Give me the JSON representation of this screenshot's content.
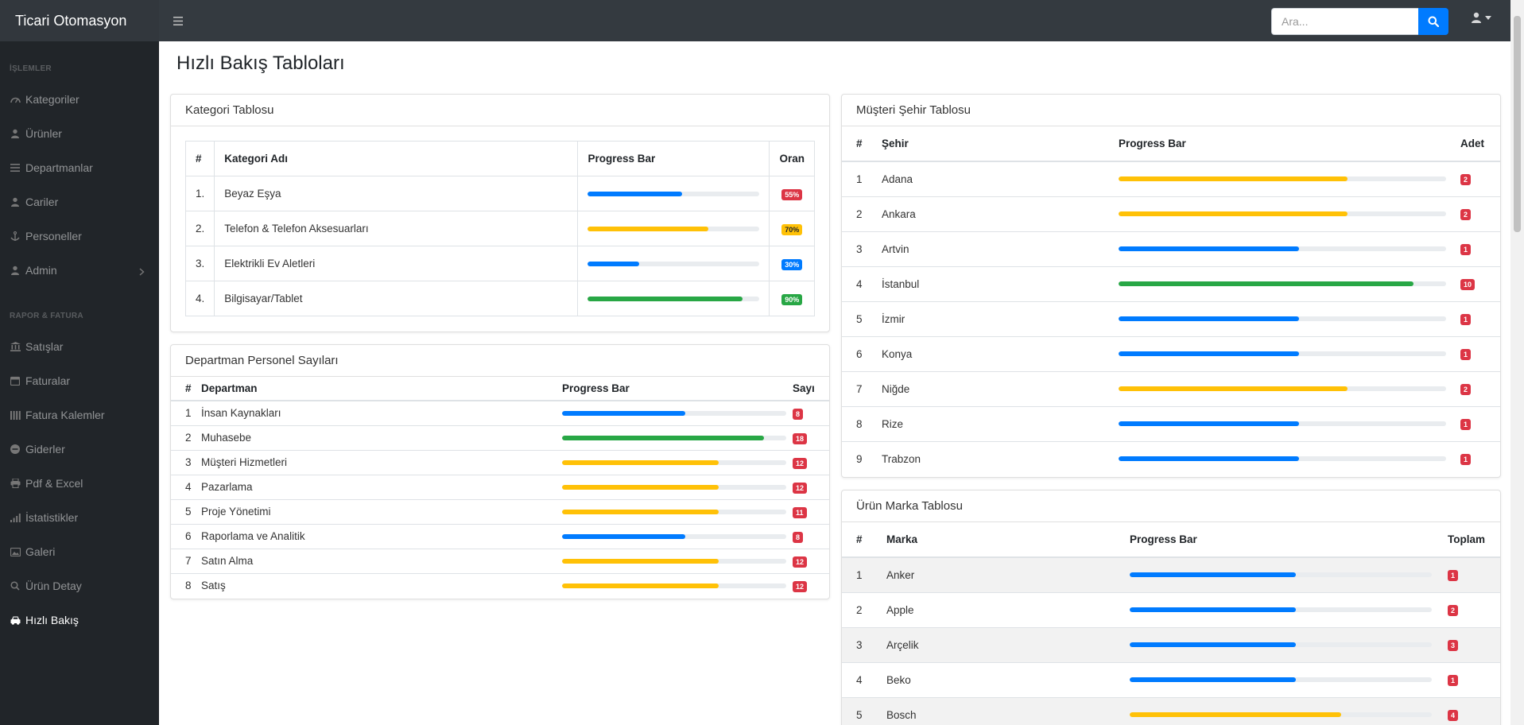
{
  "navbar": {
    "brand": "Ticari Otomasyon",
    "search_placeholder": "Ara..."
  },
  "sidebar": {
    "heading_ops": "İŞLEMLER",
    "heading_reports": "RAPOR & FATURA",
    "ops_items": [
      {
        "label": "Kategoriler",
        "icon": "dashboard-icon"
      },
      {
        "label": "Ürünler",
        "icon": "user-icon"
      },
      {
        "label": "Departmanlar",
        "icon": "list-icon"
      },
      {
        "label": "Cariler",
        "icon": "user-icon"
      },
      {
        "label": "Personeller",
        "icon": "anchor-icon"
      },
      {
        "label": "Admin",
        "icon": "user-icon"
      }
    ],
    "report_items": [
      {
        "label": "Satışlar",
        "icon": "bank-icon"
      },
      {
        "label": "Faturalar",
        "icon": "calendar-icon"
      },
      {
        "label": "Fatura Kalemler",
        "icon": "columns-icon"
      },
      {
        "label": "Giderler",
        "icon": "minus-circle-icon"
      },
      {
        "label": "Pdf & Excel",
        "icon": "print-icon"
      },
      {
        "label": "İstatistikler",
        "icon": "signal-icon"
      },
      {
        "label": "Galeri",
        "icon": "image-icon"
      },
      {
        "label": "Ürün Detay",
        "icon": "search-icon"
      },
      {
        "label": "Hızlı Bakış",
        "icon": "car-icon",
        "active": true
      }
    ]
  },
  "page_title": "Hızlı Bakış Tabloları",
  "colors": {
    "blue": "#007bff",
    "yellow": "#ffc107",
    "green": "#28a745",
    "red": "#dc3545"
  },
  "kategori": {
    "title": "Kategori Tablosu",
    "headers": [
      "#",
      "Kategori Adı",
      "Progress Bar",
      "Oran"
    ],
    "rows": [
      {
        "no": "1.",
        "name": "Beyaz Eşya",
        "progress": 55,
        "color": "blue",
        "badge": "55%",
        "badge_color": "red"
      },
      {
        "no": "2.",
        "name": "Telefon & Telefon Aksesuarları",
        "progress": 70,
        "color": "yellow",
        "badge": "70%",
        "badge_color": "yellow"
      },
      {
        "no": "3.",
        "name": "Elektrikli Ev Aletleri",
        "progress": 30,
        "color": "blue",
        "badge": "30%",
        "badge_color": "blue"
      },
      {
        "no": "4.",
        "name": "Bilgisayar/Tablet",
        "progress": 90,
        "color": "green",
        "badge": "90%",
        "badge_color": "green"
      }
    ]
  },
  "departman": {
    "title": "Departman Personel Sayıları",
    "headers": [
      "#",
      "Departman",
      "Progress Bar",
      "Sayı"
    ],
    "rows": [
      {
        "no": "1",
        "name": "İnsan Kaynakları",
        "progress": 55,
        "color": "blue",
        "count": "8"
      },
      {
        "no": "2",
        "name": "Muhasebe",
        "progress": 90,
        "color": "green",
        "count": "18"
      },
      {
        "no": "3",
        "name": "Müşteri Hizmetleri",
        "progress": 70,
        "color": "yellow",
        "count": "12"
      },
      {
        "no": "4",
        "name": "Pazarlama",
        "progress": 70,
        "color": "yellow",
        "count": "12"
      },
      {
        "no": "5",
        "name": "Proje Yönetimi",
        "progress": 70,
        "color": "yellow",
        "count": "11"
      },
      {
        "no": "6",
        "name": "Raporlama ve Analitik",
        "progress": 55,
        "color": "blue",
        "count": "8"
      },
      {
        "no": "7",
        "name": "Satın Alma",
        "progress": 70,
        "color": "yellow",
        "count": "12"
      },
      {
        "no": "8",
        "name": "Satış",
        "progress": 70,
        "color": "yellow",
        "count": "12"
      }
    ]
  },
  "musteri": {
    "title": "Müşteri Şehir Tablosu",
    "headers": [
      "#",
      "Şehir",
      "Progress Bar",
      "Adet"
    ],
    "rows": [
      {
        "no": "1",
        "name": "Adana",
        "progress": 70,
        "color": "yellow",
        "count": "2"
      },
      {
        "no": "2",
        "name": "Ankara",
        "progress": 70,
        "color": "yellow",
        "count": "2"
      },
      {
        "no": "3",
        "name": "Artvin",
        "progress": 55,
        "color": "blue",
        "count": "1"
      },
      {
        "no": "4",
        "name": "İstanbul",
        "progress": 90,
        "color": "green",
        "count": "10"
      },
      {
        "no": "5",
        "name": "İzmir",
        "progress": 55,
        "color": "blue",
        "count": "1"
      },
      {
        "no": "6",
        "name": "Konya",
        "progress": 55,
        "color": "blue",
        "count": "1"
      },
      {
        "no": "7",
        "name": "Niğde",
        "progress": 70,
        "color": "yellow",
        "count": "2"
      },
      {
        "no": "8",
        "name": "Rize",
        "progress": 55,
        "color": "blue",
        "count": "1"
      },
      {
        "no": "9",
        "name": "Trabzon",
        "progress": 55,
        "color": "blue",
        "count": "1"
      }
    ]
  },
  "marka": {
    "title": "Ürün Marka Tablosu",
    "headers": [
      "#",
      "Marka",
      "Progress Bar",
      "Toplam"
    ],
    "rows": [
      {
        "no": "1",
        "name": "Anker",
        "progress": 55,
        "color": "blue",
        "count": "1"
      },
      {
        "no": "2",
        "name": "Apple",
        "progress": 55,
        "color": "blue",
        "count": "2"
      },
      {
        "no": "3",
        "name": "Arçelik",
        "progress": 55,
        "color": "blue",
        "count": "3"
      },
      {
        "no": "4",
        "name": "Beko",
        "progress": 55,
        "color": "blue",
        "count": "1"
      },
      {
        "no": "5",
        "name": "Bosch",
        "progress": 70,
        "color": "yellow",
        "count": "4"
      }
    ]
  }
}
